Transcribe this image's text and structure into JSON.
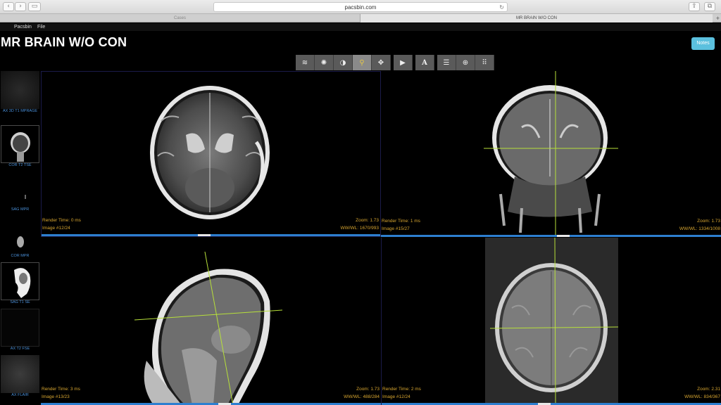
{
  "browser": {
    "url": "pacsbin.com",
    "tabs": [
      "Cases",
      "MR BRAIN W/O CON"
    ]
  },
  "menu": {
    "items": [
      "Pacsbin",
      "File"
    ]
  },
  "header": {
    "title": "MR BRAIN W/O CON",
    "notes_label": "Notes"
  },
  "toolbar": {
    "tools": [
      "layers-icon",
      "brightness-icon",
      "contrast-icon",
      "zoom-icon",
      "pan-icon",
      "play-icon",
      "annotate-icon",
      "align-icon",
      "globe-icon",
      "grid-icon"
    ],
    "text_tool_glyph": "A",
    "active_tool": "zoom-icon"
  },
  "sidebar": {
    "series": [
      {
        "label": "AX 3D T1 MPRAGE"
      },
      {
        "label": "COR T2 TSE"
      },
      {
        "label": "SAG MPR"
      },
      {
        "label": "COR MPR"
      },
      {
        "label": "SAG T1 SE"
      },
      {
        "label": "AX T2 FSE"
      },
      {
        "label": "AX FLAIR"
      }
    ]
  },
  "viewports": {
    "top_left": {
      "render_time": "Render Time: 0 ms",
      "image": "Image #12/24",
      "zoom": "Zoom: 1.73",
      "wwwl": "WW/WL: 1670/993"
    },
    "top_right": {
      "render_time": "Render Time: 1 ms",
      "image": "Image #15/27",
      "zoom": "Zoom: 1.73",
      "wwwl": "WW/WL: 1334/1008"
    },
    "bottom_left": {
      "render_time": "Render Time: 3 ms",
      "image": "Image #13/23",
      "zoom": "Zoom: 1.73",
      "wwwl": "WW/WL: 488/284"
    },
    "bottom_right": {
      "render_time": "Render Time: 2 ms",
      "image": "Image #12/24",
      "zoom": "Zoom: 2.31",
      "wwwl": "WW/WL: 834/367"
    }
  },
  "colors": {
    "accent": "#5bc0de",
    "overlay_text": "#d8a630",
    "crosshair": "#b7e03a",
    "scrollbar": "#2d7fd0",
    "series_label": "#4a90d9"
  }
}
